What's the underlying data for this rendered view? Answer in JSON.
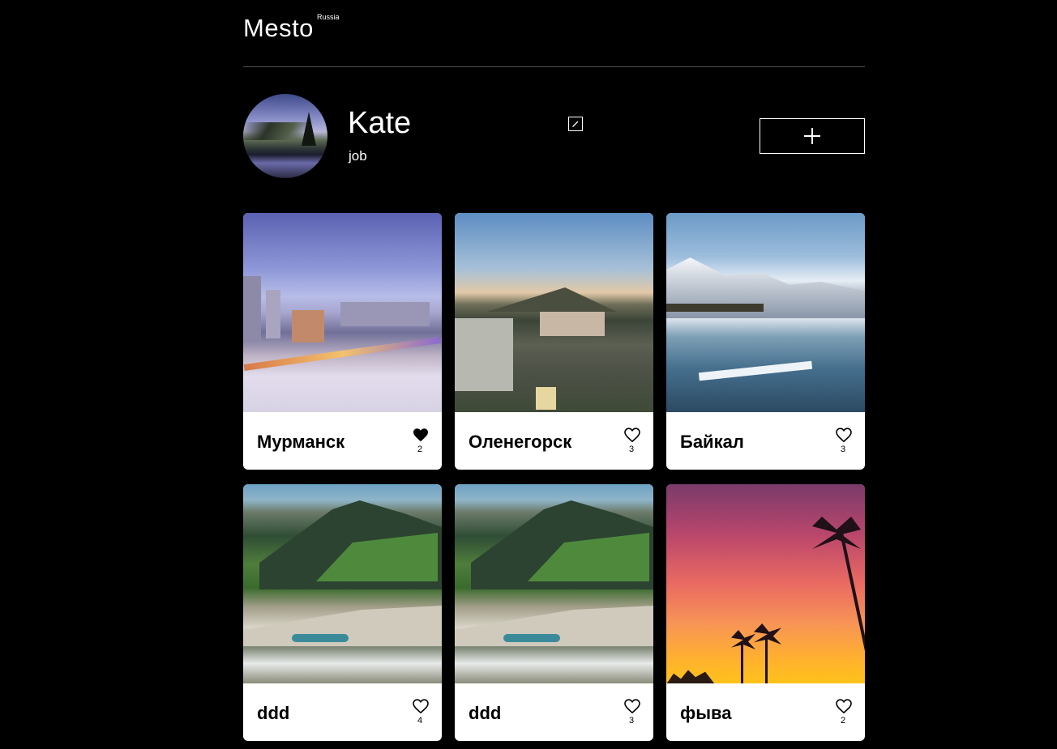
{
  "header": {
    "logo": "Mesto",
    "logo_sup": "Russia"
  },
  "profile": {
    "name": "Kate",
    "job": "job",
    "edit_icon": "pencil-icon",
    "add_icon": "plus-icon"
  },
  "cards": [
    {
      "title": "Мурманск",
      "likes": "2",
      "liked": true,
      "scene": "murmansk"
    },
    {
      "title": "Оленегорск",
      "likes": "3",
      "liked": false,
      "scene": "olenegorsk"
    },
    {
      "title": "Байкал",
      "likes": "3",
      "liked": false,
      "scene": "baikal"
    },
    {
      "title": "ddd",
      "likes": "4",
      "liked": false,
      "scene": "mountain"
    },
    {
      "title": "ddd",
      "likes": "3",
      "liked": false,
      "scene": "mountain"
    },
    {
      "title": "фыва",
      "likes": "2",
      "liked": false,
      "scene": "sunset"
    }
  ],
  "colors": {
    "background": "#000000",
    "text": "#ffffff",
    "card": "#ffffff",
    "card_text": "#000000",
    "divider": "#545454"
  }
}
